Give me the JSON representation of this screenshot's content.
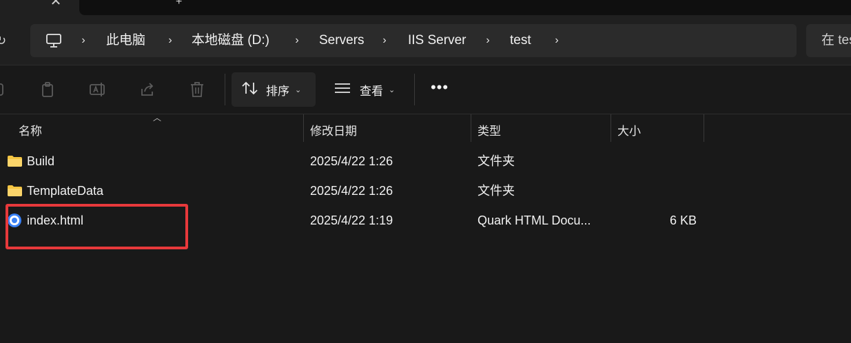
{
  "tabs": {
    "close_glyph": "✕",
    "new_glyph": "+"
  },
  "breadcrumb": {
    "items": [
      {
        "label": "此电脑"
      },
      {
        "label": "本地磁盘 (D:)"
      },
      {
        "label": "Servers"
      },
      {
        "label": "IIS Server"
      },
      {
        "label": "test"
      }
    ],
    "separator": "›"
  },
  "search": {
    "placeholder": "在 test 中搜索"
  },
  "toolbar": {
    "sort_label": "排序",
    "view_label": "查看",
    "more_label": "•••",
    "icons": [
      "copy-icon",
      "paste-icon",
      "rename-icon",
      "share-icon",
      "delete-icon"
    ]
  },
  "columns": {
    "name": "名称",
    "modified": "修改日期",
    "type": "类型",
    "size": "大小"
  },
  "files": [
    {
      "name": "Build",
      "modified": "2025/4/22 1:26",
      "type": "文件夹",
      "size": "",
      "icon": "folder-icon"
    },
    {
      "name": "TemplateData",
      "modified": "2025/4/22 1:26",
      "type": "文件夹",
      "size": "",
      "icon": "folder-icon"
    },
    {
      "name": "index.html",
      "modified": "2025/4/22 1:19",
      "type": "Quark HTML Docu...",
      "size": "6 KB",
      "icon": "html-file-icon"
    }
  ],
  "colors": {
    "background": "#191919",
    "highlight": "#e8393b",
    "folder": "#f4c542",
    "html_icon": "#3b82f6"
  }
}
